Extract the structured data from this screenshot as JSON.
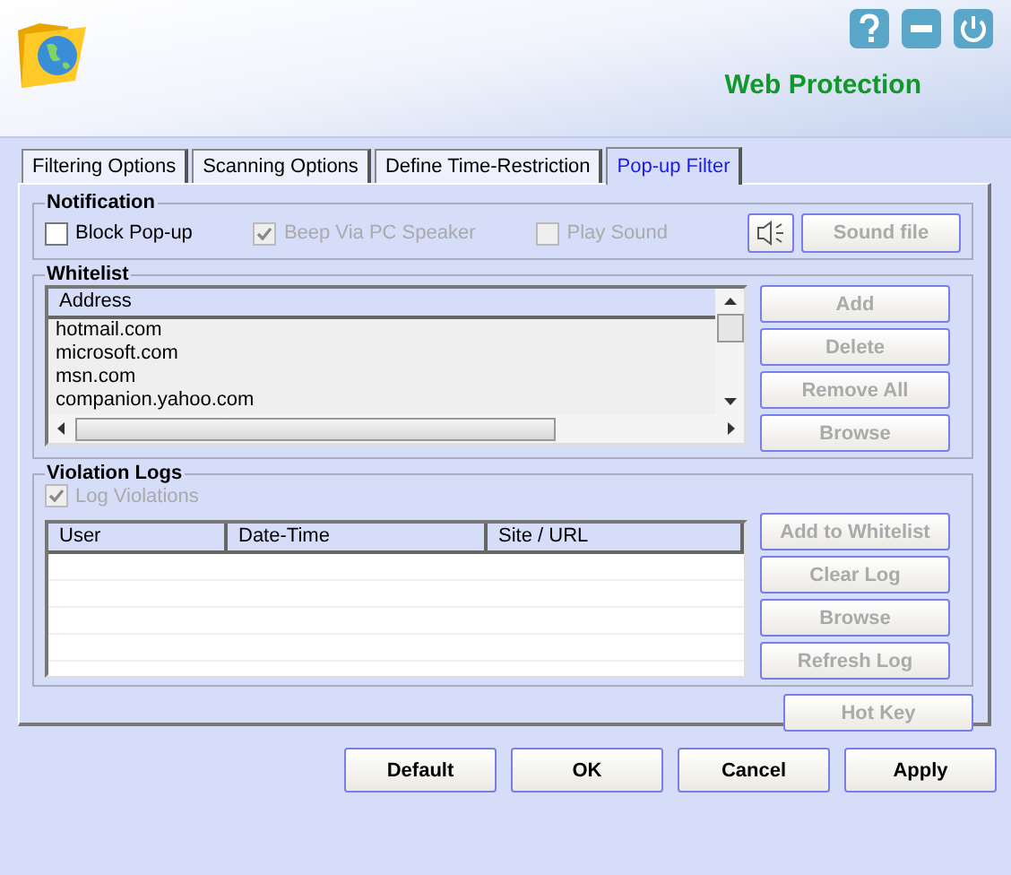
{
  "header": {
    "title": "Web Protection"
  },
  "tabs": [
    {
      "label": "Filtering Options",
      "selected": false
    },
    {
      "label": "Scanning Options",
      "selected": false
    },
    {
      "label": "Define Time-Restriction",
      "selected": false
    },
    {
      "label": "Pop-up Filter",
      "selected": true
    }
  ],
  "notification": {
    "title": "Notification",
    "options": [
      {
        "label": "Block Pop-up",
        "checked": false,
        "disabled": false
      },
      {
        "label": "Beep Via PC Speaker",
        "checked": true,
        "disabled": true
      },
      {
        "label": "Play Sound",
        "checked": false,
        "disabled": true
      }
    ],
    "sound_button": {
      "label": "Sound file",
      "disabled": true
    }
  },
  "whitelist": {
    "title": "Whitelist",
    "column": "Address",
    "rows": [
      "hotmail.com",
      "microsoft.com",
      "msn.com",
      "companion.yahoo.com"
    ],
    "buttons": [
      {
        "label": "Add",
        "disabled": true
      },
      {
        "label": "Delete",
        "disabled": true
      },
      {
        "label": "Remove All",
        "disabled": true
      },
      {
        "label": "Browse",
        "disabled": true
      }
    ]
  },
  "violation_logs": {
    "title": "Violation Logs",
    "log_option": {
      "label": "Log Violations",
      "checked": true,
      "disabled": true
    },
    "columns": [
      "User",
      "Date-Time",
      "Site / URL"
    ],
    "buttons": [
      {
        "label": "Add to Whitelist",
        "disabled": true
      },
      {
        "label": "Clear Log",
        "disabled": true
      },
      {
        "label": "Browse",
        "disabled": true
      },
      {
        "label": "Refresh Log",
        "disabled": true
      }
    ]
  },
  "hotkey_button": {
    "label": "Hot Key",
    "disabled": true
  },
  "footer_buttons": [
    {
      "label": "Default",
      "disabled": false
    },
    {
      "label": "OK",
      "disabled": false
    },
    {
      "label": "Cancel",
      "disabled": false
    },
    {
      "label": "Apply",
      "disabled": false
    }
  ]
}
